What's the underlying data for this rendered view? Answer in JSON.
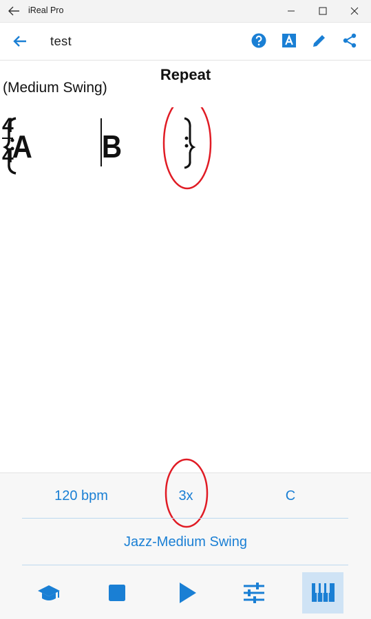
{
  "window": {
    "title": "iReal Pro"
  },
  "toolbar": {
    "song_title": "test",
    "icons": [
      "back-arrow-icon",
      "help-icon",
      "font-icon",
      "edit-icon",
      "share-icon"
    ],
    "accent_color": "#1a7fd4"
  },
  "sheet": {
    "section_title": "Repeat",
    "style_label": "(Medium Swing)",
    "time_signature": {
      "top": "4",
      "bottom": "4"
    },
    "rehearsal_marks": [
      "A",
      "B"
    ]
  },
  "bottom": {
    "tempo": "120 bpm",
    "repeats": "3x",
    "key": "C",
    "style": "Jazz-Medium Swing"
  },
  "controls": [
    "practice-icon",
    "stop-icon",
    "play-icon",
    "mixer-icon",
    "piano-icon"
  ],
  "highlight_color": "#e01b24"
}
